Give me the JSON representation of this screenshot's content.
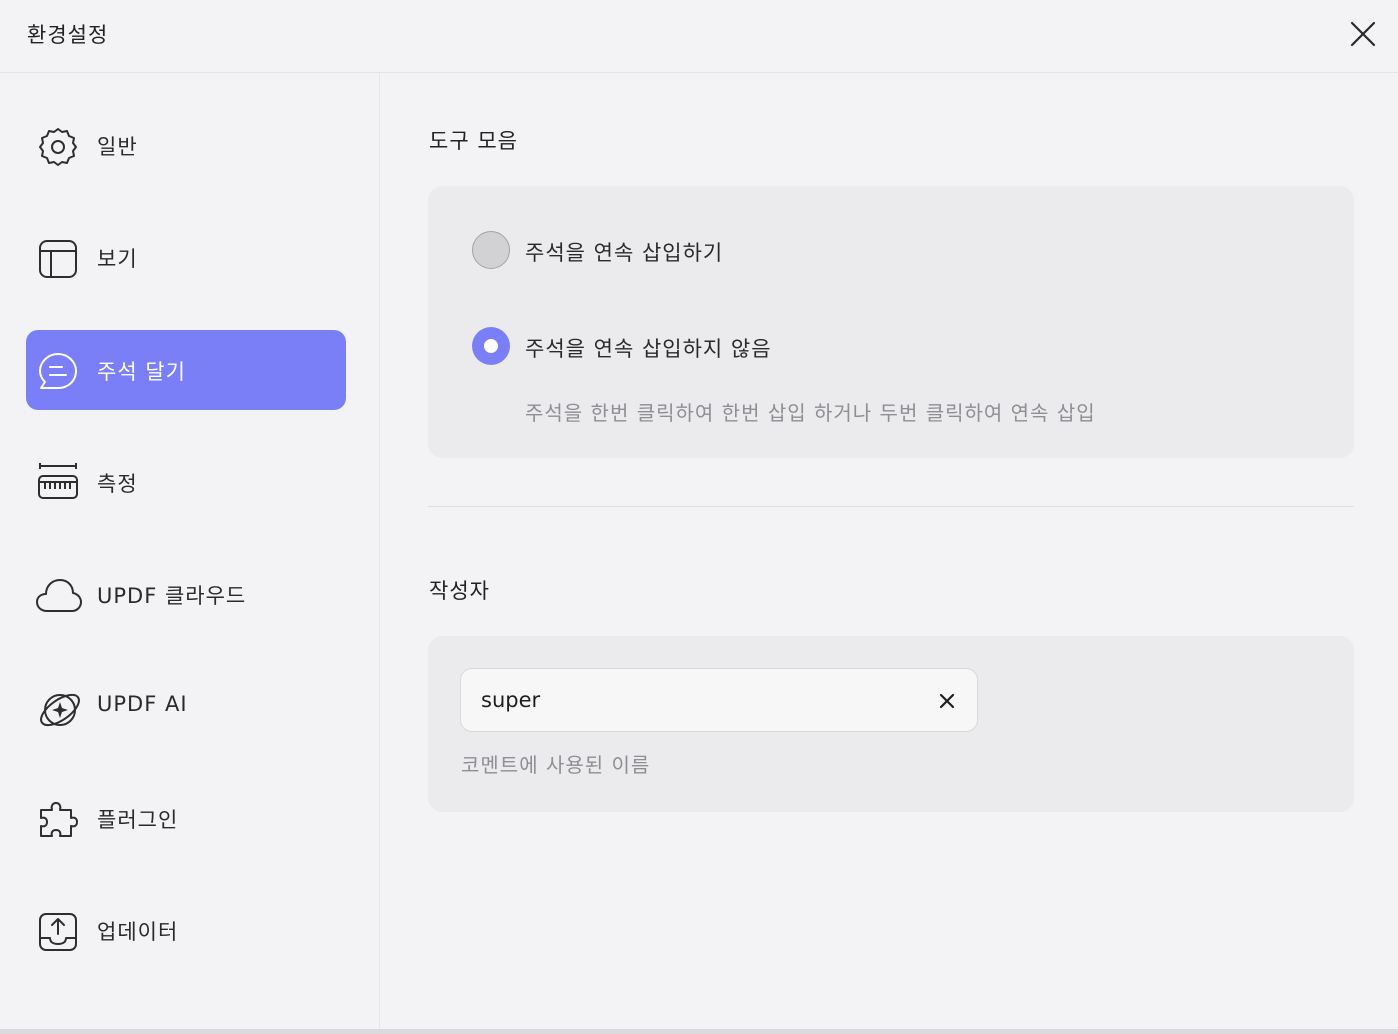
{
  "window": {
    "title": "환경설정"
  },
  "sidebar": {
    "items": [
      {
        "label": "일반",
        "icon": "gear-icon",
        "active": false
      },
      {
        "label": "보기",
        "icon": "layout-icon",
        "active": false
      },
      {
        "label": "주석 달기",
        "icon": "comment-icon",
        "active": true
      },
      {
        "label": "측정",
        "icon": "ruler-icon",
        "active": false
      },
      {
        "label": "UPDF 클라우드",
        "icon": "cloud-icon",
        "active": false
      },
      {
        "label": "UPDF AI",
        "icon": "ai-sparkle-icon",
        "active": false
      },
      {
        "label": "플러그인",
        "icon": "puzzle-icon",
        "active": false
      },
      {
        "label": "업데이터",
        "icon": "upload-icon",
        "active": false
      }
    ],
    "accent_color": "#7b7ff7"
  },
  "toolbar_section": {
    "title": "도구 모음",
    "options": [
      {
        "label": "주석을 연속 삽입하기",
        "selected": false
      },
      {
        "label": "주석을 연속 삽입하지 않음",
        "selected": true
      }
    ],
    "hint": "주석을 한번 클릭하여 한번 삽입 하거나 두번 클릭하여 연속 삽입"
  },
  "author_section": {
    "title": "작성자",
    "input_value": "super",
    "hint": "코멘트에 사용된 이름"
  }
}
